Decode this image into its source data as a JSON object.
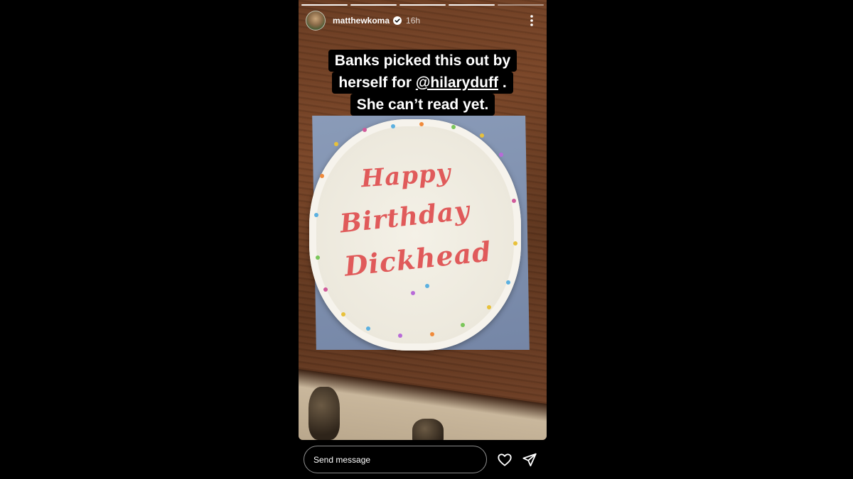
{
  "story": {
    "username": "matthewkoma",
    "time": "16h",
    "progress": {
      "segments": 5,
      "completed": 4
    }
  },
  "caption": {
    "line1": "Banks picked this out by",
    "line2_prefix": "herself for ",
    "line2_mention": "@hilaryduff",
    "line2_suffix": " .",
    "line3": "She can’t read yet."
  },
  "cake": {
    "line1": "Happy",
    "line2": "Birthday",
    "line3": "Dickhead",
    "icing_color": "#e05a5a"
  },
  "footer": {
    "message_placeholder": "Send message"
  },
  "icons": {
    "verified": "verified-badge-icon",
    "more": "more-vertical-icon",
    "like": "heart-icon",
    "share": "send-icon"
  }
}
